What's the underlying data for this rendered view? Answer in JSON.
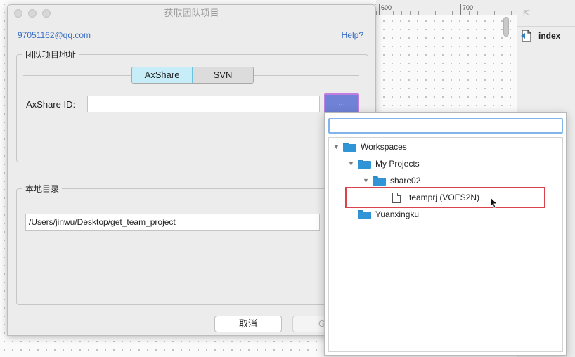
{
  "dialog": {
    "title": "获取团队项目",
    "account_email": "97051162@qq.com",
    "help_link": "Help?",
    "team_group_label": "团队项目地址",
    "segments": [
      {
        "label": "AxShare",
        "active": true
      },
      {
        "label": "SVN",
        "active": false
      }
    ],
    "axshare_id_label": "AxShare ID:",
    "axshare_id_value": "",
    "browse_button_label": "...",
    "local_group_label": "本地目录",
    "local_path_value": "/Users/jinwu/Desktop/get_team_project",
    "cancel_label": "取消",
    "ok_label_partial": "G"
  },
  "ruler": {
    "labels": [
      "600",
      "700"
    ]
  },
  "side_panel": {
    "page_item_label": "index"
  },
  "popup": {
    "search_value": "",
    "tree": [
      {
        "label": "Workspaces",
        "type": "folder",
        "expanded": true
      },
      {
        "label": "My Projects",
        "type": "folder",
        "expanded": true
      },
      {
        "label": "share02",
        "type": "folder",
        "expanded": true
      },
      {
        "label": "teamprj (VOES2N)",
        "type": "file",
        "selected": true
      },
      {
        "label": "Yuanxingku",
        "type": "folder",
        "expanded": false
      }
    ]
  },
  "colors": {
    "link": "#3a6fc4",
    "segment_active": "#c7eef8",
    "browse_button": "#6f82d6",
    "folder": "#2f95d6",
    "highlight": "#d9434d"
  }
}
